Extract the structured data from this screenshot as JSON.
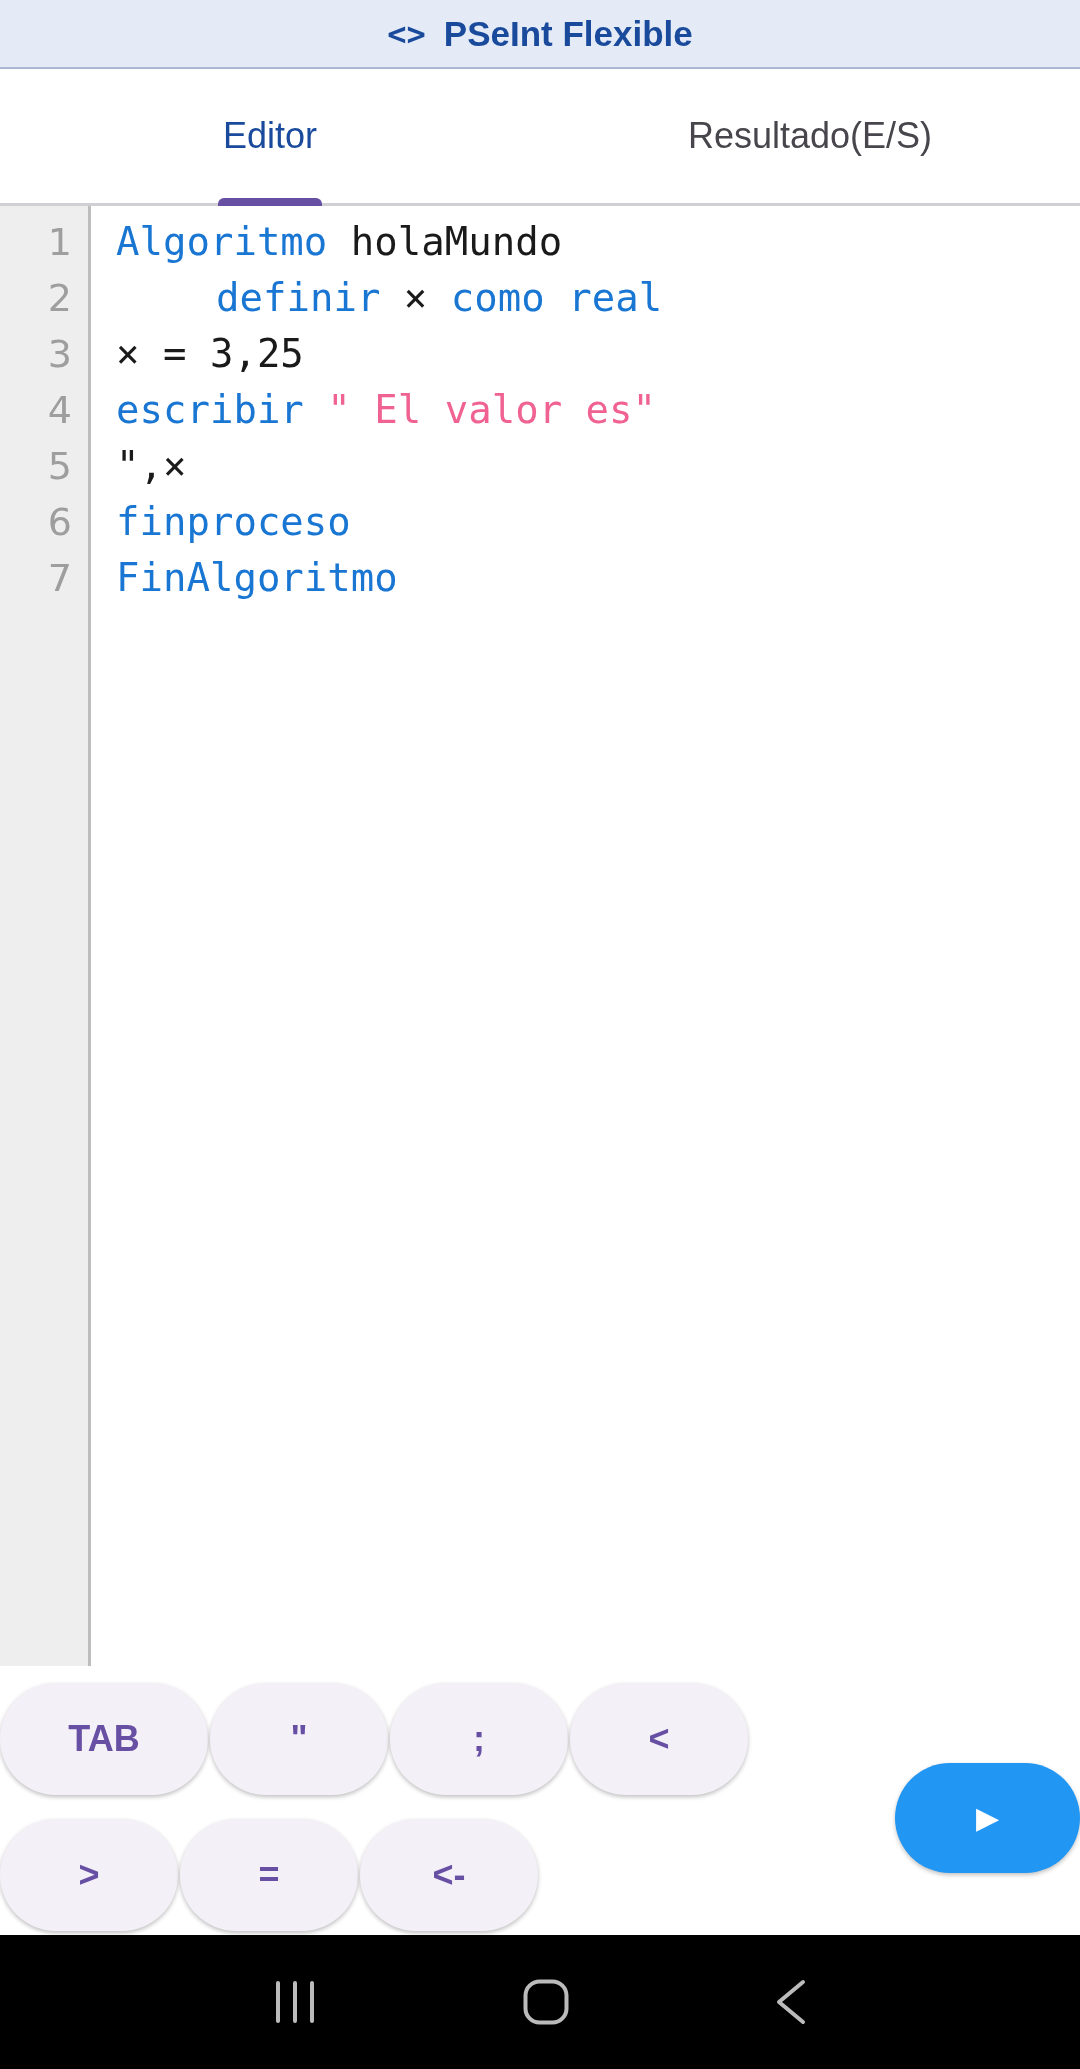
{
  "app_bar": {
    "icon": "<>",
    "title": "PSeInt Flexible"
  },
  "tabs": [
    {
      "label": "Editor",
      "selected": true
    },
    {
      "label": "Resultado(E/S)",
      "selected": false
    }
  ],
  "editor": {
    "lines": [
      {
        "number": "1",
        "indented": false,
        "tokens": [
          {
            "kind": "keyword",
            "text": "Algoritmo"
          },
          {
            "kind": "plain",
            "text": " holaMundo"
          }
        ]
      },
      {
        "number": "2",
        "indented": true,
        "tokens": [
          {
            "kind": "keyword",
            "text": "definir"
          },
          {
            "kind": "plain",
            "text": " × "
          },
          {
            "kind": "keyword",
            "text": "como real"
          }
        ]
      },
      {
        "number": "3",
        "indented": false,
        "tokens": [
          {
            "kind": "plain",
            "text": "× = 3,25"
          }
        ]
      },
      {
        "number": "4",
        "indented": false,
        "tokens": [
          {
            "kind": "keyword",
            "text": "escribir"
          },
          {
            "kind": "string",
            "text": " \" El valor es\""
          }
        ]
      },
      {
        "number": "5",
        "indented": false,
        "tokens": [
          {
            "kind": "plain",
            "text": "\",×"
          }
        ]
      },
      {
        "number": "6",
        "indented": false,
        "tokens": [
          {
            "kind": "keyword",
            "text": "finproceso"
          }
        ]
      },
      {
        "number": "7",
        "indented": false,
        "tokens": [
          {
            "kind": "keyword",
            "text": "FinAlgoritmo"
          }
        ]
      }
    ]
  },
  "key_rows": [
    [
      "TAB",
      "\"",
      ";",
      "<"
    ],
    [
      ">",
      "=",
      "<-"
    ]
  ],
  "run_button": {
    "icon": "▶"
  }
}
